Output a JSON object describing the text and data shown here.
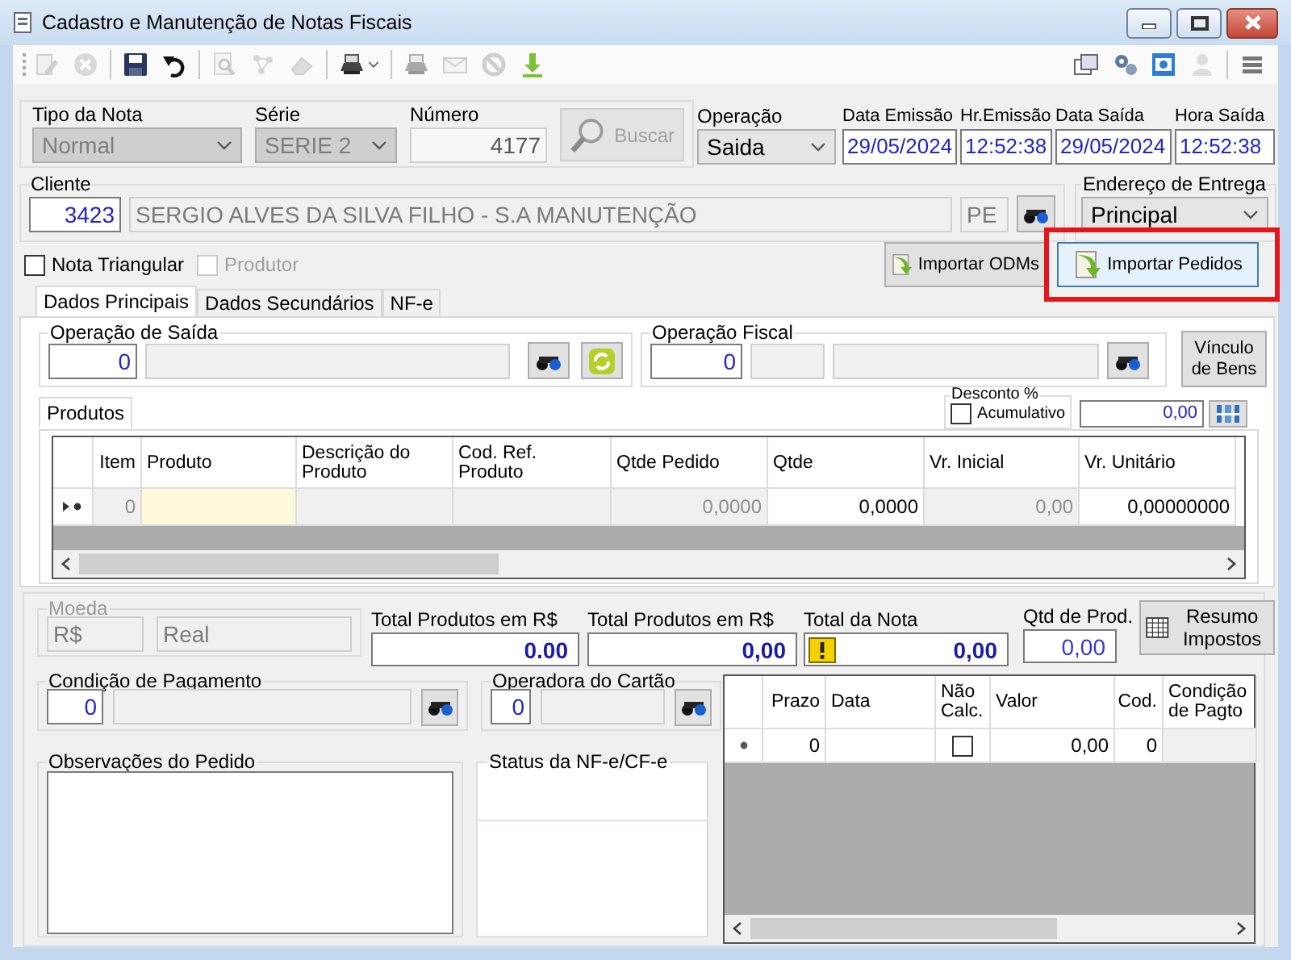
{
  "window": {
    "title": "Cadastro e Manutenção de Notas Fiscais"
  },
  "toolbar": {
    "left": [
      {
        "kind": "edit",
        "disabled": true
      },
      {
        "kind": "cancel",
        "disabled": true
      },
      {
        "kind": "separator"
      },
      {
        "kind": "save",
        "disabled": false
      },
      {
        "kind": "undo",
        "disabled": false
      },
      {
        "kind": "separator"
      },
      {
        "kind": "zoom",
        "disabled": true
      },
      {
        "kind": "network",
        "disabled": true
      },
      {
        "kind": "eraser",
        "disabled": true
      },
      {
        "kind": "separator"
      },
      {
        "kind": "printer",
        "disabled": false,
        "dropdown": true
      },
      {
        "kind": "separator"
      },
      {
        "kind": "printer",
        "disabled": true
      },
      {
        "kind": "mail",
        "disabled": true
      },
      {
        "kind": "block",
        "disabled": true
      },
      {
        "kind": "download",
        "disabled": false
      }
    ],
    "right": [
      {
        "kind": "windows",
        "disabled": false
      },
      {
        "kind": "gears",
        "disabled": false
      },
      {
        "kind": "screen",
        "disabled": false
      },
      {
        "kind": "user",
        "disabled": true
      },
      {
        "kind": "separator"
      },
      {
        "kind": "menu",
        "disabled": false
      }
    ]
  },
  "nota": {
    "tipo": {
      "label": "Tipo da Nota",
      "value": "Normal",
      "disabled": true
    },
    "serie": {
      "label": "Série",
      "value": "SERIE 2",
      "disabled": true
    },
    "numero": {
      "label": "Número",
      "value": "4177",
      "disabled": true
    },
    "buscar": {
      "label": "Buscar",
      "disabled": true
    }
  },
  "operacao": {
    "label": "Operação",
    "value": "Saida"
  },
  "datas": [
    {
      "label": "Data Emissão",
      "value": "29/05/2024"
    },
    {
      "label": "Hr.Emissão",
      "value": "12:52:38"
    },
    {
      "label": "Data Saída",
      "value": "29/05/2024"
    },
    {
      "label": "Hora Saída",
      "value": "12:52:38"
    }
  ],
  "cliente": {
    "label": "Cliente",
    "code": "3423",
    "name": "SERGIO ALVES DA SILVA FILHO - S.A MANUTENÇÃO",
    "uf": "PE"
  },
  "endereco_entrega": {
    "label": "Endereço de Entrega",
    "value": "Principal"
  },
  "options": [
    {
      "label": "Nota Triangular",
      "checked": false,
      "disabled": false
    },
    {
      "label": "Produtor",
      "checked": false,
      "disabled": true
    }
  ],
  "import_buttons": [
    {
      "label": "Importar ODMs",
      "focused": false,
      "highlighted": false
    },
    {
      "label": "Importar Pedidos",
      "focused": true,
      "highlighted": true
    }
  ],
  "tabs": [
    {
      "label": "Dados Principais",
      "selected": true
    },
    {
      "label": "Dados Secundários",
      "selected": false
    },
    {
      "label": "NF-e",
      "selected": false
    }
  ],
  "operacao_saida": {
    "label": "Operação de Saída",
    "code": "0"
  },
  "operacao_fiscal": {
    "label": "Operação Fiscal",
    "code": "0"
  },
  "vinculo_bens": {
    "label": "Vínculo de Bens"
  },
  "produtos": {
    "tabs": [
      {
        "label": "Produtos",
        "selected": true
      }
    ],
    "desconto": {
      "label": "Desconto %",
      "option": "Acumulativo",
      "checked": false,
      "value": "0,00"
    },
    "columns": [
      {
        "label": "Item",
        "readonly": true
      },
      {
        "label": "Produto",
        "readonly": false
      },
      {
        "label": "Descrição do Produto",
        "readonly": true
      },
      {
        "label": "Cod. Ref. Produto",
        "readonly": true
      },
      {
        "label": "Qtde Pedido",
        "readonly": true
      },
      {
        "label": "Qtde",
        "readonly": false
      },
      {
        "label": "Vr. Inicial",
        "readonly": true
      },
      {
        "label": "Vr. Unitário",
        "readonly": false
      }
    ],
    "rows": [
      {
        "cells": [
          {
            "text": "0",
            "focused": false
          },
          {
            "focused": true
          },
          {
            "focused": false
          },
          {
            "focused": false
          },
          {
            "text": "0,0000",
            "focused": false
          },
          {
            "text": "0,0000",
            "focused": false
          },
          {
            "text": "0,00",
            "focused": false
          },
          {
            "text": "0,00000000",
            "focused": false
          }
        ]
      }
    ]
  },
  "moeda": {
    "label": "Moeda",
    "code": "R$",
    "name": "Real",
    "disabled": true
  },
  "totais": [
    {
      "kind": "total",
      "label": "Total Produtos em R$",
      "value": "0.00",
      "warning": false
    },
    {
      "kind": "total",
      "label": "Total Produtos em R$",
      "value": "0,00",
      "warning": false
    },
    {
      "kind": "total",
      "label": "Total da Nota",
      "value": "0,00",
      "warning": true
    },
    {
      "kind": "count",
      "label": "Qtd de Prod.",
      "value": "0,00",
      "warning": false
    }
  ],
  "resumo_impostos": {
    "label": "Resumo Impostos"
  },
  "condicao_pagamento": {
    "label": "Condição de Pagamento",
    "code": "0"
  },
  "operadora_cartao": {
    "label": "Operadora do Cartão",
    "code": "0"
  },
  "observacoes": {
    "label": "Observações do Pedido"
  },
  "status_nfe": {
    "label": "Status da NF-e/CF-e"
  },
  "parcelas": {
    "columns": [
      {
        "label": "Prazo",
        "readonly": false
      },
      {
        "label": "Data",
        "readonly": false
      },
      {
        "label": "Não Calc.",
        "readonly": false
      },
      {
        "label": "Valor",
        "readonly": false
      },
      {
        "label": "Cod.",
        "readonly": false
      },
      {
        "label": "Condição de Pagto",
        "readonly": true
      }
    ],
    "rows": [
      {
        "cells": [
          {
            "kind": "text",
            "text": "0"
          },
          {
            "kind": "text"
          },
          {
            "kind": "check",
            "checked": false
          },
          {
            "kind": "text",
            "text": "0,00"
          },
          {
            "kind": "text",
            "text": "0"
          },
          {
            "kind": "text"
          }
        ]
      }
    ]
  }
}
